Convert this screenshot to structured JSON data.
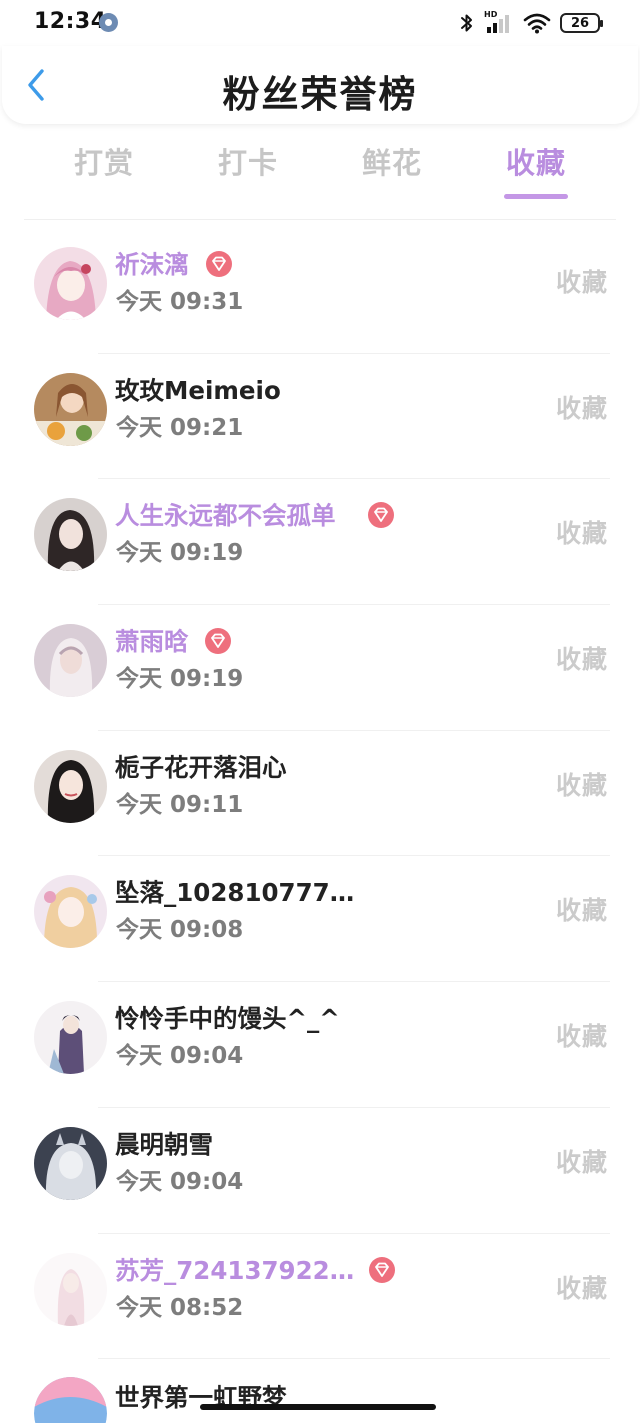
{
  "status_bar": {
    "time": "12:34",
    "hd_label": "HD",
    "battery": "26"
  },
  "header": {
    "title": "粉丝荣誉榜"
  },
  "tabs": [
    {
      "label": "打赏",
      "active": false
    },
    {
      "label": "打卡",
      "active": false
    },
    {
      "label": "鲜花",
      "active": false
    },
    {
      "label": "收藏",
      "active": true
    }
  ],
  "colors": {
    "accent": "#b98ddf",
    "vip_badge": "#ee6f7d",
    "action_gray": "#cbcbcb",
    "back_arrow": "#3d9be9"
  },
  "fans": [
    {
      "name": "祈沫漓",
      "vip": true,
      "time": "今天 09:31",
      "action": "收藏"
    },
    {
      "name": "玫玫Meimeio",
      "vip": false,
      "time": "今天 09:21",
      "action": "收藏"
    },
    {
      "name": "人生永远都不会孤单",
      "vip": true,
      "time": "今天 09:19",
      "action": "收藏"
    },
    {
      "name": "萧雨晗",
      "vip": true,
      "time": "今天 09:19",
      "action": "收藏"
    },
    {
      "name": "栀子花开落泪心",
      "vip": false,
      "time": "今天 09:11",
      "action": "收藏"
    },
    {
      "name": "坠落_102810777...",
      "vip": false,
      "time": "今天 09:08",
      "action": "收藏"
    },
    {
      "name": "怜怜手中的馒头^_^",
      "vip": false,
      "time": "今天 09:04",
      "action": "收藏"
    },
    {
      "name": "晨明朝雪",
      "vip": false,
      "time": "今天 09:04",
      "action": "收藏"
    },
    {
      "name": "苏芳_724137922...",
      "vip": true,
      "time": "今天 08:52",
      "action": "收藏"
    }
  ],
  "partial_row": {
    "name": "世界第一虹野梦"
  }
}
